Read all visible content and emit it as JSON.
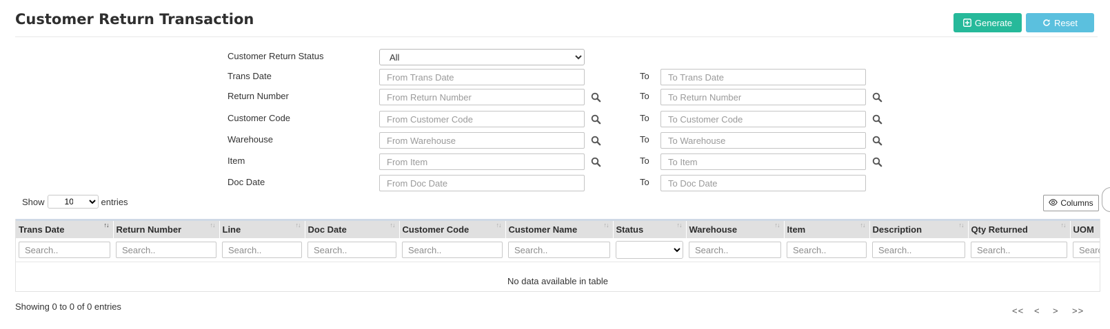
{
  "page": {
    "title": "Customer Return Transaction",
    "generate_label": "Generate",
    "reset_label": "Reset"
  },
  "colors": {
    "generate": "#26b99a",
    "reset": "#5bc0de",
    "header_bg": "#e0e0e0"
  },
  "icons": {
    "generate": "plus-square-icon",
    "reset": "refresh-icon",
    "lookup": "search-icon",
    "columns": "eye-icon"
  },
  "filters": {
    "status_label": "Customer Return Status",
    "status_value": "All",
    "to_label": "To",
    "rows": [
      {
        "label": "Trans Date",
        "from_placeholder": "From Trans Date",
        "to_placeholder": "To Trans Date"
      },
      {
        "label": "Return Number",
        "from_placeholder": "From Return Number",
        "to_placeholder": "To Return Number"
      },
      {
        "label": "Customer Code",
        "from_placeholder": "From Customer Code",
        "to_placeholder": "To Customer Code"
      },
      {
        "label": "Warehouse",
        "from_placeholder": "From Warehouse",
        "to_placeholder": "To Warehouse"
      },
      {
        "label": "Item",
        "from_placeholder": "From Item",
        "to_placeholder": "To Item"
      },
      {
        "label": "Doc Date",
        "from_placeholder": "From Doc Date",
        "to_placeholder": "To Doc Date"
      }
    ]
  },
  "table_controls": {
    "show_label": "Show",
    "entries_label": "entries",
    "page_length": "10",
    "columns_label": "Columns"
  },
  "table": {
    "columns": [
      "Trans Date",
      "Return Number",
      "Line",
      "Doc Date",
      "Customer Code",
      "Customer Name",
      "Status",
      "Warehouse",
      "Item",
      "Description",
      "Qty Returned",
      "UOM"
    ],
    "search_placeholder": "Search..",
    "empty_message": "No data available in table",
    "info": "Showing 0 to 0 of 0 entries"
  },
  "pagination": {
    "first": "<<",
    "prev": "<",
    "next": ">",
    "last": ">>"
  }
}
